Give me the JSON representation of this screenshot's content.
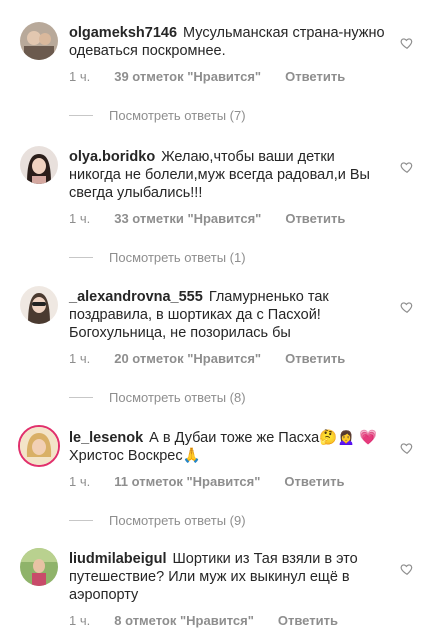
{
  "comments": [
    {
      "username": "olgameksh7146",
      "text": "Мусульманская страна-нужно одеваться поскромнее.",
      "time": "1 ч.",
      "likes": "39 отметок \"Нравится\"",
      "reply": "Ответить",
      "view_replies": "Посмотреть ответы (7)"
    },
    {
      "username": "olya.boridko",
      "text": "Желаю,чтобы ваши детки никогда не болели,муж всегда радовал,и Вы свегда улыбались!!!",
      "time": "1 ч.",
      "likes": "33 отметки \"Нравится\"",
      "reply": "Ответить",
      "view_replies": "Посмотреть ответы (1)"
    },
    {
      "username": "_alexandrovna_555",
      "text": "Гламурненько так поздравила, в шортиках да с Пасхой! Богохульница, не позорилась бы",
      "time": "1 ч.",
      "likes": "20 отметок \"Нравится\"",
      "reply": "Ответить",
      "view_replies": "Посмотреть ответы (8)"
    },
    {
      "username": "le_lesenok",
      "text": "А в Дубаи тоже же Пасха🤔🙍‍♀️ 💗 Христос Воскрес🙏",
      "time": "1 ч.",
      "likes": "11 отметок \"Нравится\"",
      "reply": "Ответить",
      "view_replies": "Посмотреть ответы (9)"
    },
    {
      "username": "liudmilabeigul",
      "text": "Шортики из Тая взяли в это путешествие? Или муж их выкинул ещё в аэропорту",
      "time": "1 ч.",
      "likes": "8 отметок \"Нравится\"",
      "reply": "Ответить"
    }
  ]
}
